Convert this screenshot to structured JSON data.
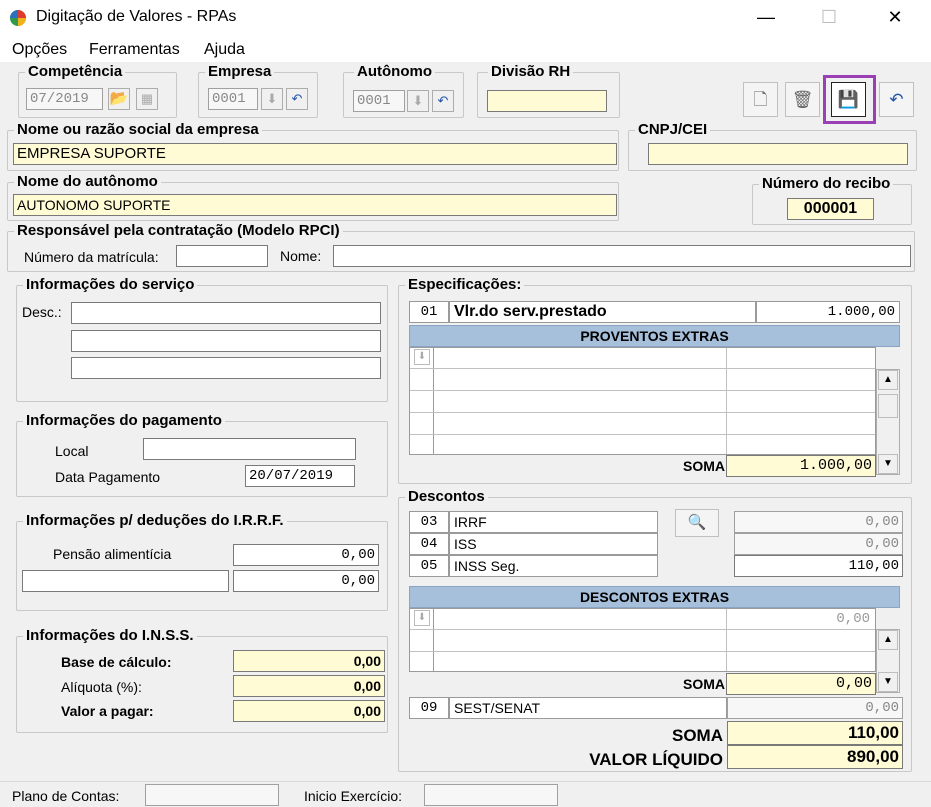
{
  "window": {
    "title": "Digitação de Valores - RPAs",
    "minimize": "—",
    "maximize": "☐",
    "close": "✕"
  },
  "menu": [
    "Opções",
    "Ferramentas",
    "Ajuda"
  ],
  "competencia": {
    "label": "Competência",
    "value": "07/2019"
  },
  "empresa": {
    "label": "Empresa",
    "value": "0001"
  },
  "autonomo": {
    "label": "Autônomo",
    "value": "0001"
  },
  "divisao": {
    "label": "Divisão RH",
    "value": ""
  },
  "razao_social": {
    "label": "Nome ou razão social da empresa",
    "value": "EMPRESA SUPORTE"
  },
  "cnpj": {
    "label": "CNPJ/CEI",
    "value": ""
  },
  "nome_autonomo": {
    "label": "Nome do autônomo",
    "value": "AUTONOMO SUPORTE"
  },
  "recibo": {
    "label": "Número do recibo",
    "value": "000001"
  },
  "responsavel": {
    "label": "Responsável pela contratação (Modelo RPCI)",
    "matricula_label": "Número da matrícula:",
    "matricula": "",
    "nome_label": "Nome:",
    "nome": ""
  },
  "servico": {
    "label": "Informações do serviço",
    "desc_label": "Desc.:",
    "desc": [
      "",
      "",
      ""
    ]
  },
  "pagamento": {
    "label": "Informações do pagamento",
    "local_label": "Local",
    "local": "",
    "data_label": "Data Pagamento",
    "data": "20/07/2019"
  },
  "irrf": {
    "label": "Informações p/ deduções do I.R.R.F.",
    "pensao_label": "Pensão alimentícia",
    "pensao": "0,00",
    "outro_label": "",
    "outro": "0,00"
  },
  "inss": {
    "label": "Informações do I.N.S.S.",
    "base_label": "Base de cálculo:",
    "base": "0,00",
    "aliquota_label": "Alíquota (%):",
    "aliquota": "0,00",
    "valor_label": "Valor a pagar:",
    "valor": "0,00"
  },
  "especificacoes": {
    "label": "Especificações:",
    "code": "01",
    "desc": "Vlr.do serv.prestado",
    "value": "1.000,00",
    "extras_header": "PROVENTOS EXTRAS",
    "soma_label": "SOMA",
    "soma": "1.000,00"
  },
  "descontos": {
    "label": "Descontos",
    "rows": [
      {
        "code": "03",
        "desc": "IRRF",
        "value": "0,00"
      },
      {
        "code": "04",
        "desc": "ISS",
        "value": "0,00"
      },
      {
        "code": "05",
        "desc": "INSS Seg.",
        "value": "110,00"
      }
    ],
    "extras_header": "DESCONTOS EXTRAS",
    "extras_value": "0,00",
    "soma_label": "SOMA",
    "soma": "0,00",
    "sest": {
      "code": "09",
      "desc": "SEST/SENAT",
      "value": "0,00"
    },
    "total_label": "SOMA",
    "total": "110,00",
    "liquido_label": "VALOR LÍQUIDO",
    "liquido": "890,00"
  },
  "status": {
    "plano_label": "Plano de Contas:",
    "plano": "",
    "inicio_label": "Inicio Exercício:",
    "inicio": ""
  },
  "colors": {
    "highlight": "#9b3fb5",
    "header": "#a6c0dc",
    "yellow": "#fffbd5"
  }
}
